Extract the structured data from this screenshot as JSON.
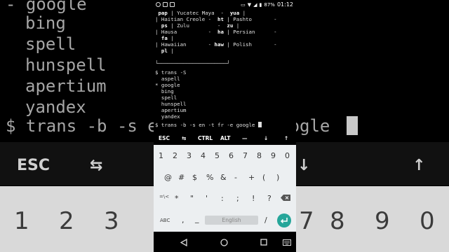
{
  "background": {
    "terminal_lines": [
      "- google",
      "bing",
      "spell",
      "hunspell",
      "apertium",
      "yandex",
      "$ trans -b -s en -t fr -e google"
    ],
    "extra_keys": [
      "ESC",
      "⇆",
      "CT",
      "↓",
      "↑"
    ],
    "numbers": [
      "1",
      "2",
      "3",
      "4",
      "7",
      "8",
      "9",
      "0"
    ]
  },
  "status_bar": {
    "battery": "87%",
    "time": "01:12"
  },
  "terminal": {
    "table_rows": [
      {
        "a_pre": " ",
        "a_bold": "pap",
        "a_post": " | Yucatec Maya  -",
        "b_pre": "  ",
        "b_bold": "yua",
        "b_post": " |"
      },
      {
        "a_pre": "| Haitian Creole -",
        "a_bold": "",
        "a_post": "",
        "b_pre": "  ",
        "b_bold": "ht",
        "b_post": " | Pashto       -"
      },
      {
        "a_pre": "  ",
        "a_bold": "ps",
        "a_post": " | Zulu         -",
        "b_pre": "  ",
        "b_bold": "zu",
        "b_post": " |"
      },
      {
        "a_pre": "| Hausa          -",
        "a_bold": "",
        "a_post": "",
        "b_pre": "  ",
        "b_bold": "ha",
        "b_post": " | Persian      -"
      },
      {
        "a_pre": "  ",
        "a_bold": "fa",
        "a_post": " |",
        "b_pre": "",
        "b_bold": "",
        "b_post": ""
      },
      {
        "a_pre": "| Hawaiian       -",
        "a_bold": "",
        "a_post": "",
        "b_pre": " ",
        "b_bold": "haw",
        "b_post": " | Polish       -"
      },
      {
        "a_pre": "  ",
        "a_bold": "pl",
        "a_post": " |",
        "b_pre": "",
        "b_bold": "",
        "b_post": ""
      }
    ],
    "divider": "└──────────────────────┘",
    "command1": "$ trans -S",
    "engines": [
      "  aspell",
      "* google",
      "  bing",
      "  spell",
      "  hunspell",
      "  apertium",
      "  yandex"
    ],
    "command2": "$ trans -b -s en -t fr -e google "
  },
  "extra_keys": [
    "ESC",
    "⇆",
    "CTRL",
    "ALT",
    "—",
    "↓",
    "↑"
  ],
  "keyboard": {
    "row1": [
      "1",
      "2",
      "3",
      "4",
      "5",
      "6",
      "7",
      "8",
      "9",
      "0"
    ],
    "row2": [
      "@",
      "#",
      "$",
      "%",
      "&",
      "-",
      "+",
      "(",
      ")"
    ],
    "row3": [
      "=\\<",
      "*",
      "\"",
      "'",
      ":",
      ";",
      "!",
      "?"
    ],
    "row4_left": "ABC",
    "row4_comma": ",",
    "row4_underscore": "_",
    "space_label": "English",
    "row4_slash": "/",
    "row4_period": ".",
    "enter_icon": "enter-arrow-icon",
    "backspace_icon": "backspace-icon"
  },
  "navbar": {
    "icons": [
      "back-triangle-icon",
      "home-circle-icon",
      "recents-square-icon",
      "keyboard-switch-icon"
    ]
  },
  "colors": {
    "accent": "#26a69a",
    "keyboard_bg": "#eceff1",
    "terminal_bg": "#000000"
  }
}
